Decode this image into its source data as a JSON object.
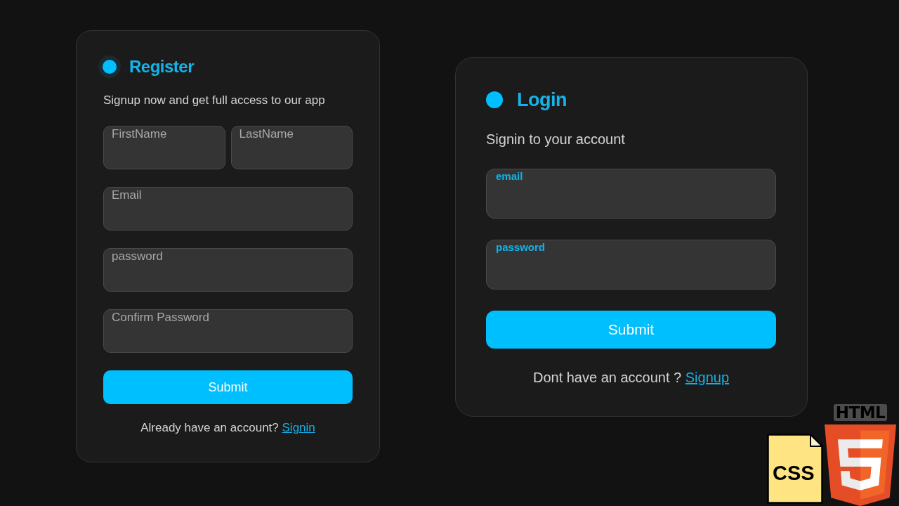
{
  "register": {
    "title": "Register",
    "glow": true,
    "subtitle": "Signup now and get full access to our app",
    "name_fields": [
      {
        "placeholder": "FirstName"
      },
      {
        "placeholder": "LastName"
      }
    ],
    "fields": [
      {
        "placeholder": "Email"
      },
      {
        "placeholder": "password"
      },
      {
        "placeholder": "Confirm Password"
      }
    ],
    "submit": "Submit",
    "footer": {
      "text": "Already have an account?",
      "link": "Signin"
    }
  },
  "login": {
    "title": "Login",
    "glow": false,
    "subtitle": "Signin to your account",
    "fields": [
      {
        "label": "email"
      },
      {
        "label": "password"
      }
    ],
    "submit": "Submit",
    "footer": {
      "text": "Dont have an account ?",
      "link": "Signup"
    }
  },
  "logos": {
    "html": "HTML",
    "css": "CSS"
  }
}
